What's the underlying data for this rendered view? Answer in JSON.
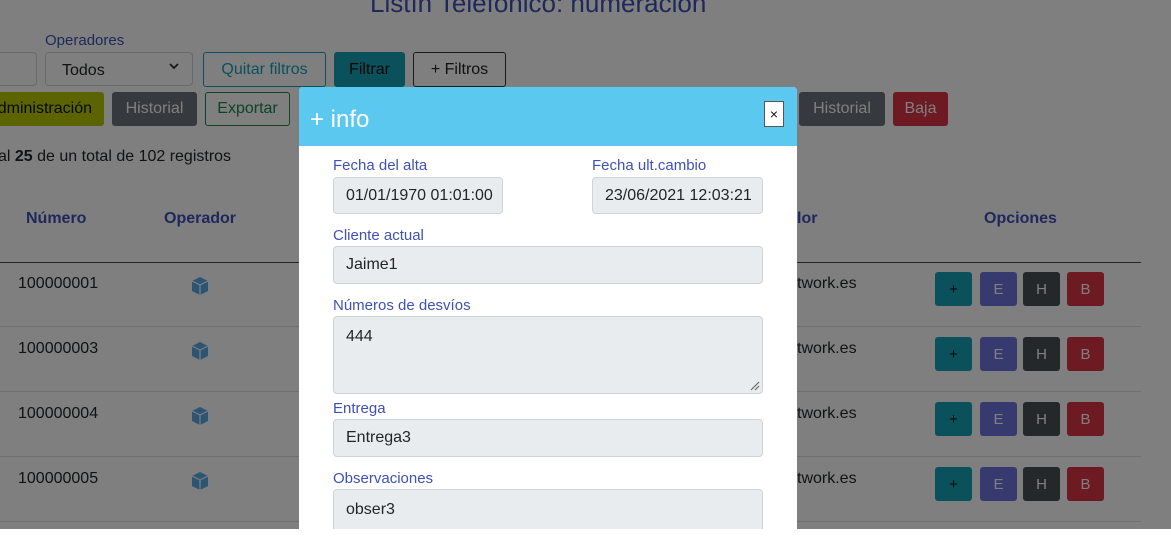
{
  "page": {
    "title": "Listín Telefónico: numeración"
  },
  "filters": {
    "operadores_label": "Operadores",
    "operadores_value": "Todos",
    "quitar_label": "Quitar filtros",
    "filtrar_label": "Filtrar",
    "mas_filtros_label": "+ Filtros"
  },
  "actions": {
    "admin_label": "Administración",
    "historial_label": "Historial",
    "exportar_label": "Exportar",
    "historial2_label": "Historial",
    "baja_label": "Baja"
  },
  "records": {
    "prefix": "al ",
    "shown": "25",
    "suffix": " de un total de 102 registros"
  },
  "table": {
    "headers": {
      "numero": "Número",
      "operador": "Operador",
      "proveedor_tail": "lor",
      "opciones": "Opciones"
    },
    "rows": [
      {
        "numero": "100000001",
        "provider_tail": "twork.es"
      },
      {
        "numero": "100000003",
        "provider_tail": "twork.es"
      },
      {
        "numero": "100000004",
        "provider_tail": "twork.es"
      },
      {
        "numero": "100000005",
        "provider_tail": "twork.es"
      }
    ],
    "option_labels": {
      "plus": "+",
      "edit": "E",
      "hist": "H",
      "baja": "B"
    }
  },
  "modal": {
    "title": "+ info",
    "close": "×",
    "fecha_alta_label": "Fecha del alta",
    "fecha_alta": "01/01/1970 01:01:00",
    "fecha_cambio_label": "Fecha ult.cambio",
    "fecha_cambio": "23/06/2021 12:03:21",
    "cliente_label": "Cliente actual",
    "cliente": "Jaime1",
    "desvios_label": "Números de desvíos",
    "desvios": "444",
    "entrega_label": "Entrega",
    "entrega": "Entrega3",
    "observaciones_label": "Observaciones",
    "observaciones": "obser3"
  },
  "colors": {
    "accent": "#3f51b5",
    "header": "#5bc8ef",
    "info": "#17a2b8",
    "danger": "#dc3545",
    "secondary": "#6c757d"
  },
  "icons": {
    "operator": "cube-icon",
    "dropdown": "chevron-down-icon",
    "close": "close-icon"
  }
}
